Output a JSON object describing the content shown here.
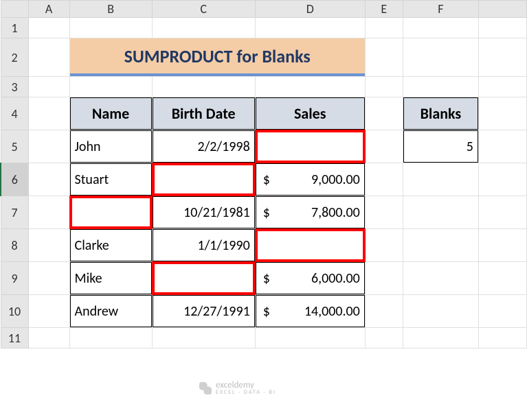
{
  "columns": [
    "",
    "A",
    "B",
    "C",
    "D",
    "E",
    "F",
    ""
  ],
  "row_headers": [
    "1",
    "2",
    "3",
    "4",
    "5",
    "6",
    "7",
    "8",
    "9",
    "10",
    "11"
  ],
  "selected_row": "6",
  "title": "SUMPRODUCT for Blanks",
  "headers": {
    "name": "Name",
    "birth": "Birth Date",
    "sales": "Sales",
    "blanks": "Blanks"
  },
  "rows": [
    {
      "name": "John",
      "birth": "2/2/1998",
      "sales": "",
      "hl": {
        "name": false,
        "birth": false,
        "sales": true
      }
    },
    {
      "name": "Stuart",
      "birth": "",
      "sales": "$   9,000.00",
      "hl": {
        "name": false,
        "birth": true,
        "sales": false
      }
    },
    {
      "name": "",
      "birth": "10/21/1981",
      "sales": "$   7,800.00",
      "hl": {
        "name": true,
        "birth": false,
        "sales": false
      }
    },
    {
      "name": "Clarke",
      "birth": "1/1/1990",
      "sales": "",
      "hl": {
        "name": false,
        "birth": false,
        "sales": true
      }
    },
    {
      "name": "Mike",
      "birth": "",
      "sales": "$   6,000.00",
      "hl": {
        "name": false,
        "birth": true,
        "sales": false
      }
    },
    {
      "name": "Andrew",
      "birth": "12/27/1991",
      "sales": "$ 14,000.00",
      "hl": {
        "name": false,
        "birth": false,
        "sales": false
      }
    }
  ],
  "blanks_value": "5",
  "watermark": {
    "main": "exceldemy",
    "sub": "EXCEL · DATA · BI"
  },
  "chart_data": {
    "type": "table",
    "title": "SUMPRODUCT for Blanks",
    "columns": [
      "Name",
      "Birth Date",
      "Sales"
    ],
    "rows": [
      [
        "John",
        "2/2/1998",
        null
      ],
      [
        "Stuart",
        null,
        9000.0
      ],
      [
        null,
        "10/21/1981",
        7800.0
      ],
      [
        "Clarke",
        "1/1/1990",
        null
      ],
      [
        "Mike",
        null,
        6000.0
      ],
      [
        "Andrew",
        "12/27/1991",
        14000.0
      ]
    ],
    "summary": {
      "Blanks": 5
    }
  }
}
